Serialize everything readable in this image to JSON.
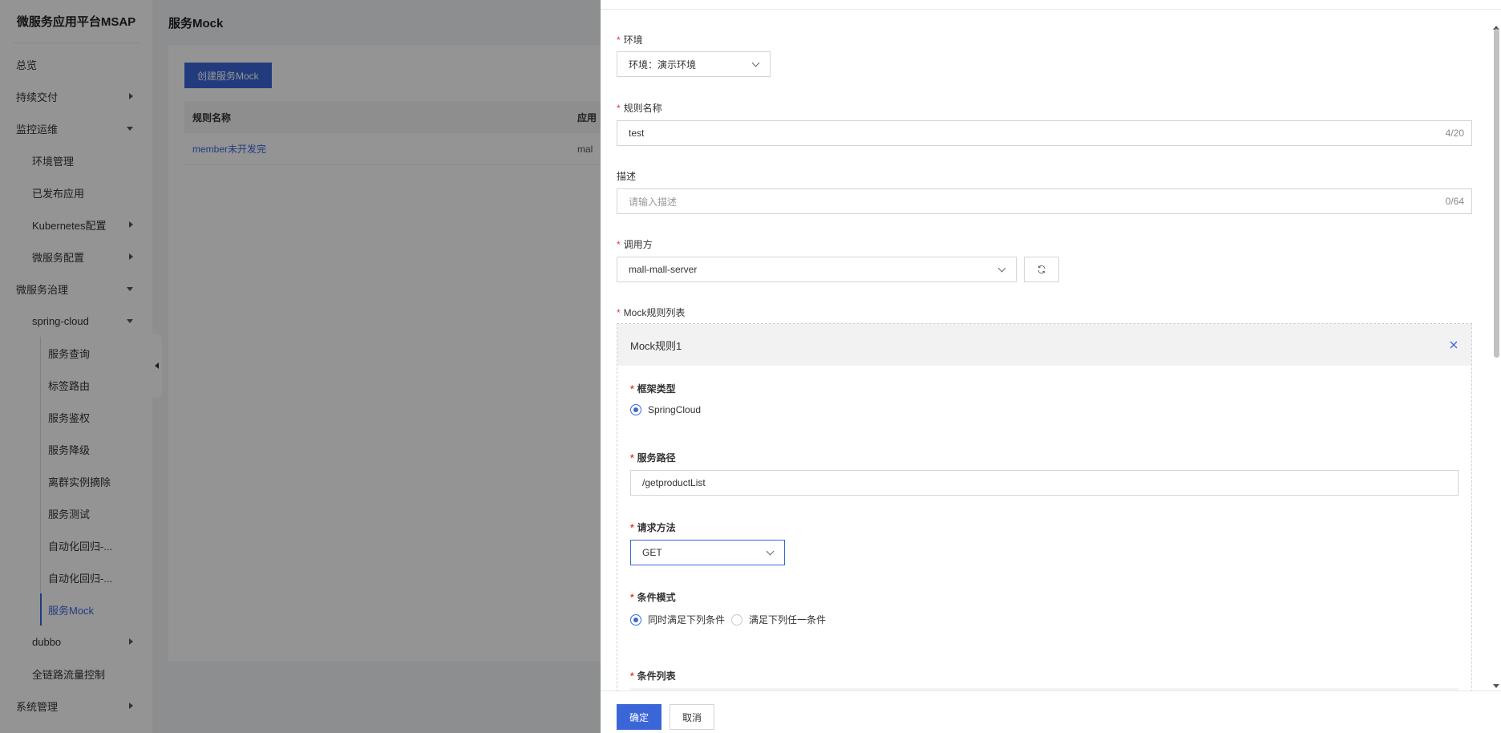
{
  "sidebar": {
    "brand": "微服务应用平台MSAP",
    "items": [
      {
        "label": "总览"
      },
      {
        "label": "持续交付"
      },
      {
        "label": "监控运维"
      },
      {
        "label": "环境管理"
      },
      {
        "label": "已发布应用"
      },
      {
        "label": "Kubernetes配置"
      },
      {
        "label": "微服务配置"
      },
      {
        "label": "微服务治理"
      },
      {
        "label": "spring-cloud"
      },
      {
        "label": "服务查询"
      },
      {
        "label": "标签路由"
      },
      {
        "label": "服务鉴权"
      },
      {
        "label": "服务降级"
      },
      {
        "label": "离群实例摘除"
      },
      {
        "label": "服务测试"
      },
      {
        "label": "自动化回归-..."
      },
      {
        "label": "自动化回归-..."
      },
      {
        "label": "服务Mock"
      },
      {
        "label": "dubbo"
      },
      {
        "label": "全链路流量控制"
      },
      {
        "label": "系统管理"
      }
    ]
  },
  "page": {
    "title": "服务Mock",
    "create_button": "创建服务Mock",
    "table": {
      "headers": [
        "规则名称",
        "应用"
      ],
      "rows": [
        [
          "member未开发完",
          "mal"
        ]
      ]
    }
  },
  "drawer": {
    "env": {
      "label": "环境",
      "value": "环境：演示环境"
    },
    "rule_name": {
      "label": "规则名称",
      "value": "test",
      "counter": "4/20"
    },
    "description": {
      "label": "描述",
      "placeholder": "请输入描述",
      "counter": "0/64"
    },
    "caller": {
      "label": "调用方",
      "value": "mall-mall-server"
    },
    "mock_rules": {
      "label": "Mock规则列表",
      "rule_title": "Mock规则1",
      "framework": {
        "label": "框架类型",
        "option": "SpringCloud"
      },
      "path": {
        "label": "服务路径",
        "value": "/getproductList"
      },
      "method": {
        "label": "请求方法",
        "value": "GET"
      },
      "condition_mode": {
        "label": "条件模式",
        "options": [
          "同时满足下列条件",
          "满足下列任一条件"
        ]
      },
      "condition_list": {
        "label": "条件列表"
      }
    },
    "footer": {
      "ok": "确定",
      "cancel": "取消"
    }
  },
  "colors": {
    "primary": "#3a66d8",
    "required": "#e4393c"
  }
}
